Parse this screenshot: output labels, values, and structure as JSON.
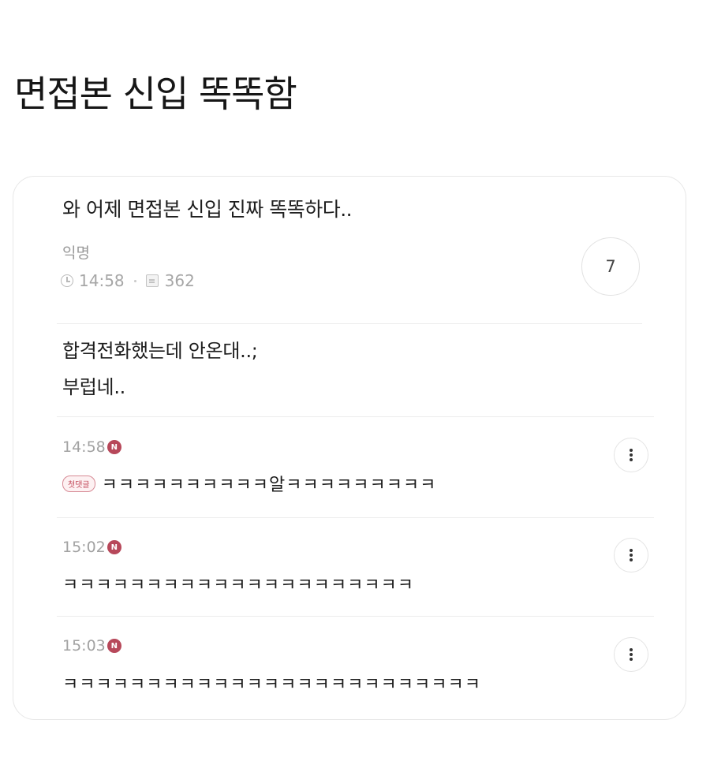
{
  "page_title": "면접본 신입 똑똑함",
  "post": {
    "title": "와 어제 면접본 신입 진짜 똑똑하다..",
    "author": "익명",
    "time": "14:58",
    "views": "362",
    "comment_count": "7",
    "body_line1": "합격전화했는데 안온대..;",
    "body_line2": "부럽네.."
  },
  "comments": [
    {
      "time": "14:58",
      "new_badge": "N",
      "first_comment_label": "첫댓글",
      "text": "ㅋㅋㅋㅋㅋㅋㅋㅋㅋㅋ알ㅋㅋㅋㅋㅋㅋㅋㅋㅋ"
    },
    {
      "time": "15:02",
      "new_badge": "N",
      "text": "ㅋㅋㅋㅋㅋㅋㅋㅋㅋㅋㅋㅋㅋㅋㅋㅋㅋㅋㅋㅋㅋ"
    },
    {
      "time": "15:03",
      "new_badge": "N",
      "text": "ㅋㅋㅋㅋㅋㅋㅋㅋㅋㅋㅋㅋㅋㅋㅋㅋㅋㅋㅋㅋㅋㅋㅋㅋㅋ"
    }
  ],
  "colors": {
    "new_badge": "#b7485a",
    "first_comment_badge": "#c24a5a",
    "meta_text": "#a6a6a6"
  }
}
